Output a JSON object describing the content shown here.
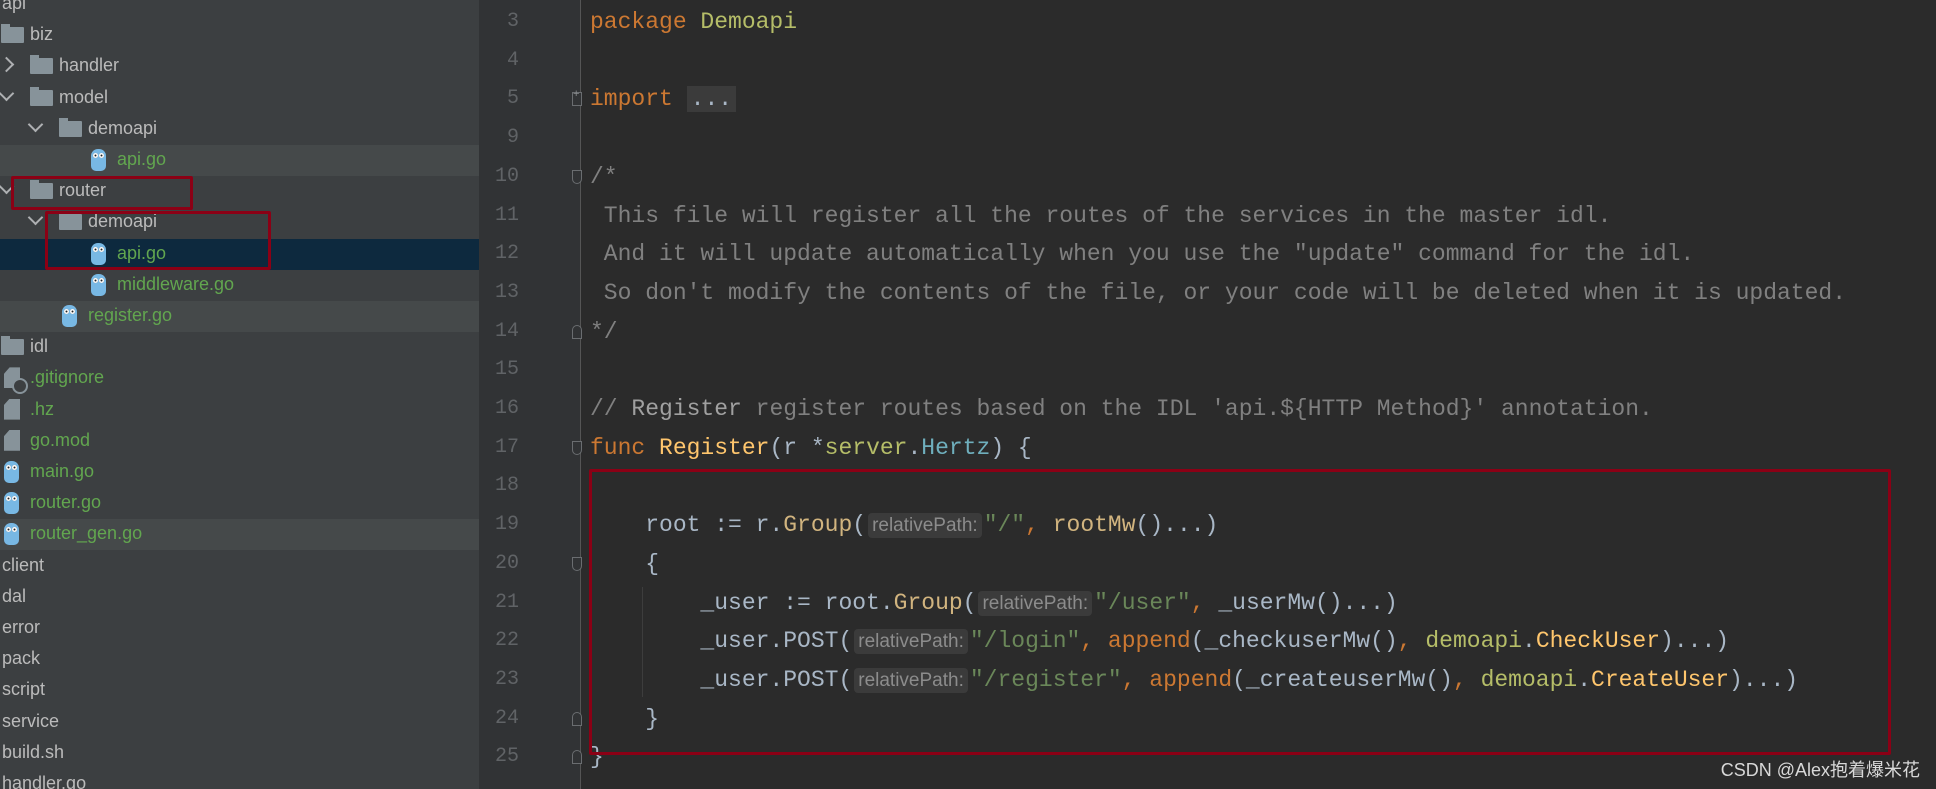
{
  "project_tree": [
    {
      "label": "api",
      "depth": 0,
      "kind": "plain"
    },
    {
      "label": "biz",
      "depth": 0,
      "kind": "folder"
    },
    {
      "label": "handler",
      "depth": 1,
      "kind": "folder",
      "chevron": "right"
    },
    {
      "label": "model",
      "depth": 1,
      "kind": "folder",
      "chevron": "down"
    },
    {
      "label": "demoapi",
      "depth": 2,
      "kind": "folder",
      "chevron": "down"
    },
    {
      "label": "api.go",
      "depth": 3,
      "kind": "go",
      "state": "hl"
    },
    {
      "label": "router",
      "depth": 1,
      "kind": "folder",
      "chevron": "down"
    },
    {
      "label": "demoapi",
      "depth": 2,
      "kind": "folder",
      "chevron": "down"
    },
    {
      "label": "api.go",
      "depth": 3,
      "kind": "go",
      "state": "sel"
    },
    {
      "label": "middleware.go",
      "depth": 3,
      "kind": "go"
    },
    {
      "label": "register.go",
      "depth": 2,
      "kind": "go",
      "state": "hl"
    },
    {
      "label": "idl",
      "depth": 0,
      "kind": "folder"
    },
    {
      "label": ".gitignore",
      "depth": 0,
      "kind": "ignore"
    },
    {
      "label": ".hz",
      "depth": 0,
      "kind": "doc"
    },
    {
      "label": "go.mod",
      "depth": 0,
      "kind": "doc"
    },
    {
      "label": "main.go",
      "depth": 0,
      "kind": "go"
    },
    {
      "label": "router.go",
      "depth": 0,
      "kind": "go"
    },
    {
      "label": "router_gen.go",
      "depth": 0,
      "kind": "go",
      "state": "hl"
    },
    {
      "label": "client",
      "depth": 0,
      "kind": "plain"
    },
    {
      "label": "dal",
      "depth": 0,
      "kind": "plain"
    },
    {
      "label": "error",
      "depth": 0,
      "kind": "plain"
    },
    {
      "label": "pack",
      "depth": 0,
      "kind": "plain"
    },
    {
      "label": "script",
      "depth": 0,
      "kind": "plain"
    },
    {
      "label": "service",
      "depth": 0,
      "kind": "plain"
    },
    {
      "label": "build.sh",
      "depth": 0,
      "kind": "plain"
    },
    {
      "label": "handler.go",
      "depth": 0,
      "kind": "plain"
    }
  ],
  "editor": {
    "lines": [
      {
        "n": "3",
        "tokens": [
          [
            "kw",
            "package "
          ],
          [
            "pkg",
            "Demoapi"
          ]
        ]
      },
      {
        "n": "4",
        "tokens": []
      },
      {
        "n": "5",
        "fold": "plus",
        "tokens": [
          [
            "kw",
            "import"
          ],
          [
            "op",
            " "
          ],
          [
            "fold",
            "..."
          ]
        ]
      },
      {
        "n": "9",
        "tokens": []
      },
      {
        "n": "10",
        "fold": "open",
        "tokens": [
          [
            "cm",
            "/*"
          ]
        ]
      },
      {
        "n": "11",
        "tokens": [
          [
            "cm",
            " This file will register all the routes of the services in the master idl."
          ]
        ]
      },
      {
        "n": "12",
        "tokens": [
          [
            "cm",
            " And it will update automatically when you use the \"update\" command for the idl."
          ]
        ]
      },
      {
        "n": "13",
        "tokens": [
          [
            "cm",
            " So don't modify the contents of the file, or your code will be deleted when it is updated."
          ]
        ]
      },
      {
        "n": "14",
        "fold": "close",
        "tokens": [
          [
            "cm",
            "*/"
          ]
        ]
      },
      {
        "n": "15",
        "tokens": []
      },
      {
        "n": "16",
        "tokens": [
          [
            "cm",
            "// "
          ],
          [
            "cmb",
            "Register"
          ],
          [
            "cm",
            " register routes based on the IDL 'api.${HTTP Method}' annotation."
          ]
        ]
      },
      {
        "n": "17",
        "fold": "open",
        "tokens": [
          [
            "kw",
            "func "
          ],
          [
            "fn",
            "Register"
          ],
          [
            "op",
            "(r *"
          ],
          [
            "pkg",
            "server"
          ],
          [
            "op",
            "."
          ],
          [
            "type",
            "Hertz"
          ],
          [
            "op",
            ") {"
          ]
        ]
      },
      {
        "n": "18",
        "tokens": []
      },
      {
        "n": "19",
        "tokens": [
          [
            "op",
            "    root := r."
          ],
          [
            "mth",
            "Group"
          ],
          [
            "op",
            "("
          ],
          [
            "hint",
            "relativePath:"
          ],
          [
            "str",
            "\"/\""
          ],
          [
            "kw",
            ", "
          ],
          [
            "mth",
            "rootMw"
          ],
          [
            "op",
            "()...)"
          ]
        ]
      },
      {
        "n": "20",
        "fold": "open",
        "tokens": [
          [
            "op",
            "    {"
          ]
        ]
      },
      {
        "n": "21",
        "tokens": [
          [
            "op",
            "        _user := root."
          ],
          [
            "mth",
            "Group"
          ],
          [
            "op",
            "("
          ],
          [
            "hint",
            "relativePath:"
          ],
          [
            "str",
            "\"/user\""
          ],
          [
            "kw",
            ", "
          ],
          [
            "op",
            "_userMw()...)"
          ]
        ]
      },
      {
        "n": "22",
        "tokens": [
          [
            "op",
            "        _user.POST("
          ],
          [
            "hint",
            "relativePath:"
          ],
          [
            "str",
            "\"/login\""
          ],
          [
            "kw",
            ", append"
          ],
          [
            "op",
            "(_checkuserMw()"
          ],
          [
            "kw",
            ", "
          ],
          [
            "pkg",
            "demoapi"
          ],
          [
            "op",
            "."
          ],
          [
            "fn",
            "CheckUser"
          ],
          [
            "op",
            ")...)"
          ]
        ]
      },
      {
        "n": "23",
        "tokens": [
          [
            "op",
            "        _user.POST("
          ],
          [
            "hint",
            "relativePath:"
          ],
          [
            "str",
            "\"/register\""
          ],
          [
            "kw",
            ", append"
          ],
          [
            "op",
            "(_createuserMw()"
          ],
          [
            "kw",
            ", "
          ],
          [
            "pkg",
            "demoapi"
          ],
          [
            "op",
            "."
          ],
          [
            "fn",
            "CreateUser"
          ],
          [
            "op",
            ")...)"
          ]
        ]
      },
      {
        "n": "24",
        "fold": "close",
        "tokens": [
          [
            "op",
            "    }"
          ]
        ]
      },
      {
        "n": "25",
        "fold": "close",
        "tokens": [
          [
            "op",
            "}"
          ]
        ]
      }
    ]
  },
  "watermark": "CSDN @Alex抱着爆米花",
  "colors": {
    "highlight_box": "#8b0015",
    "keyword": "#cc7832",
    "string": "#6a8759",
    "function": "#ffc66d",
    "comment": "#808080",
    "selection": "#0d293e"
  }
}
